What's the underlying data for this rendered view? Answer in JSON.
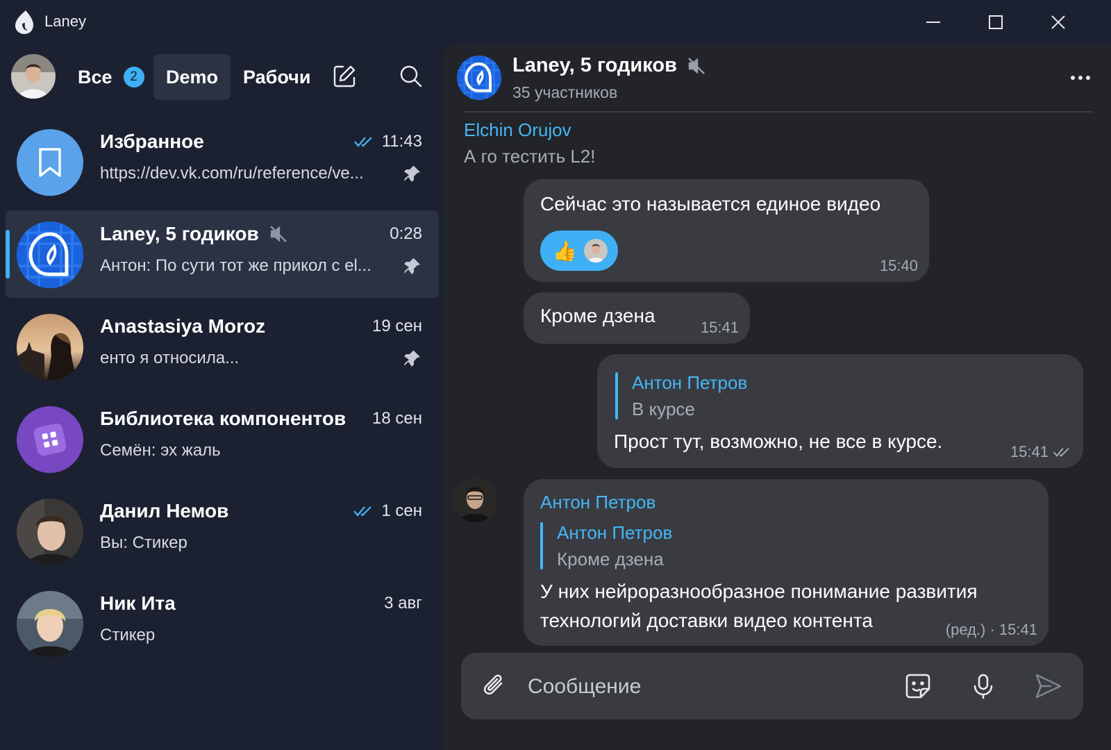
{
  "window": {
    "title": "Laney",
    "colors": {
      "accent": "#3fb0f5",
      "sidebar_bg": "#1c2131",
      "chat_bg": "#222429",
      "bubble": "#393b41"
    }
  },
  "folders": {
    "all_label": "Все",
    "all_badge": "2",
    "demo_label": "Demo",
    "work_label": "Рабочи"
  },
  "chats": [
    {
      "name": "Избранное",
      "time": "11:43",
      "read": true,
      "preview": "https://dev.vk.com/ru/reference/ve...",
      "pinned": true,
      "icon": "bookmark-icon"
    },
    {
      "name": "Laney, 5 годиков",
      "time": "0:28",
      "muted": true,
      "preview": "Антон: По сути тот же прикол с el...",
      "pinned": true,
      "selected": true
    },
    {
      "name": "Anastasiya Moroz",
      "time": "19 сен",
      "preview": "енто я относила...",
      "pinned": true
    },
    {
      "name": "Библиотека компонентов",
      "time": "18 сен",
      "preview": "Семён: эх жаль",
      "icon": "components-icon"
    },
    {
      "name": "Данил Немов",
      "time": "1 сен",
      "read": true,
      "preview": "Вы: Стикер"
    },
    {
      "name": "Ник Ита",
      "time": "3 авг",
      "preview": "Стикер"
    }
  ],
  "header": {
    "title": "Laney, 5 годиков",
    "subtitle": "35 участников"
  },
  "messages": {
    "prev_sender": "Elchin Orujov",
    "prev_text": "А го тестить L2!",
    "m1_text": "Сейчас это называется единое видео",
    "m1_reaction": "👍",
    "m1_time": "15:40",
    "m2_text": "Кроме дзена",
    "m2_time": "15:41",
    "m3_reply_name": "Антон Петров",
    "m3_reply_text": "В курсе",
    "m3_text": "Прост тут, возможно, не все в курсе.",
    "m3_time": "15:41",
    "m4_sender": "Антон Петров",
    "m4_reply_name": "Антон Петров",
    "m4_reply_text": "Кроме дзена",
    "m4_text_line1": "У них нейроразнообразное понимание развития",
    "m4_text_line2": "технологий доставки видео контента",
    "m4_time": "(ред.) · 15:41"
  },
  "composer": {
    "placeholder": "Сообщение"
  }
}
